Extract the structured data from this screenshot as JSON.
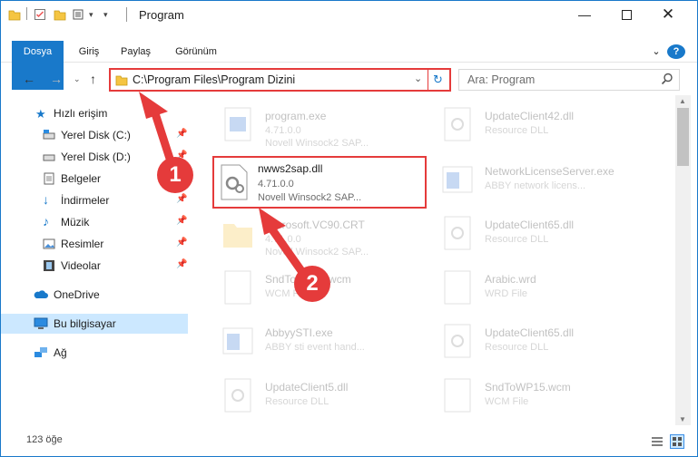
{
  "window": {
    "title": "Program"
  },
  "ribbon": {
    "tabs": [
      "Dosya",
      "Giriş",
      "Paylaş",
      "Görünüm"
    ]
  },
  "address": {
    "path": "C:\\Program Files\\Program Dizini"
  },
  "search": {
    "placeholder": "Ara: Program"
  },
  "sidebar": {
    "items": [
      {
        "label": "Hızlı erişim"
      },
      {
        "label": "Yerel Disk (C:)"
      },
      {
        "label": "Yerel Disk (D:)"
      },
      {
        "label": "Belgeler"
      },
      {
        "label": "İndirmeler"
      },
      {
        "label": "Müzik"
      },
      {
        "label": "Resimler"
      },
      {
        "label": "Videolar"
      },
      {
        "label": "OneDrive"
      },
      {
        "label": "Bu bilgisayar"
      },
      {
        "label": "Ağ"
      }
    ]
  },
  "files": [
    {
      "name": "program.exe",
      "line1": "4.71.0.0",
      "line2": "Novell Winsock2 SAP..."
    },
    {
      "name": "UpdateClient42.dll",
      "line1": "Resource DLL",
      "line2": ""
    },
    {
      "name": "nwws2sap.dll",
      "line1": "4.71.0.0",
      "line2": "Novell Winsock2 SAP..."
    },
    {
      "name": "NetworkLicenseServer.exe",
      "line1": "ABBY network licens...",
      "line2": ""
    },
    {
      "name": "Microsoft.VC90.CRT",
      "line1": "4.71.0.0",
      "line2": "Novell Winsock2 SAP..."
    },
    {
      "name": "UpdateClient65.dll",
      "line1": "Resource DLL",
      "line2": ""
    },
    {
      "name": "SndToWP15.wcm",
      "line1": "WCM File",
      "line2": ""
    },
    {
      "name": "Arabic.wrd",
      "line1": "WRD File",
      "line2": ""
    },
    {
      "name": "AbbyySTI.exe",
      "line1": "ABBY sti event hand...",
      "line2": ""
    },
    {
      "name": "UpdateClient65.dll",
      "line1": "Resource DLL",
      "line2": ""
    },
    {
      "name": "UpdateClient5.dll",
      "line1": "Resource DLL",
      "line2": ""
    },
    {
      "name": "SndToWP15.wcm",
      "line1": "WCM File",
      "line2": ""
    }
  ],
  "status": {
    "count": "123 öğe"
  },
  "annotations": {
    "step1": "1",
    "step2": "2"
  },
  "colors": {
    "accent": "#1979ca",
    "highlight": "#e53b3b",
    "selected": "#cce8ff"
  }
}
